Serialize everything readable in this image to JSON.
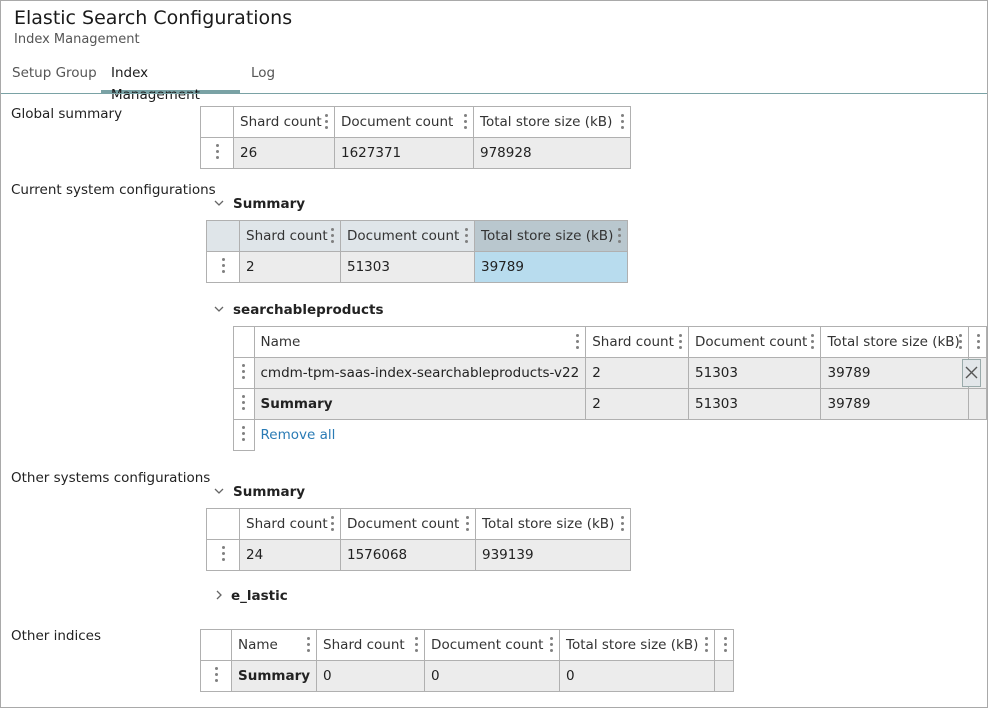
{
  "header": {
    "title": "Elastic Search Configurations",
    "subtitle": "Index Management"
  },
  "tabs": [
    {
      "label": "Setup Group",
      "active": false
    },
    {
      "label": "Index Management",
      "active": true
    },
    {
      "label": "Log",
      "active": false
    }
  ],
  "labels": {
    "global": "Global summary",
    "current": "Current system configurations",
    "other_systems": "Other systems configurations",
    "other_indices": "Other indices"
  },
  "columns": {
    "name": "Name",
    "shard": "Shard count",
    "doc": "Document count",
    "size": "Total store size (kB)"
  },
  "global_summary": {
    "shard": "26",
    "doc": "1627371",
    "size": "978928"
  },
  "current": {
    "summary_title": "Summary",
    "summary": {
      "shard": "2",
      "doc": "51303",
      "size": "39789"
    },
    "group_title": "searchableproducts",
    "rows": [
      {
        "name": "cmdm-tpm-saas-index-searchableproducts-v22",
        "shard": "2",
        "doc": "51303",
        "size": "39789"
      }
    ],
    "summary_row": {
      "name": "Summary",
      "shard": "2",
      "doc": "51303",
      "size": "39789"
    },
    "remove_all": "Remove all"
  },
  "other_systems": {
    "summary_title": "Summary",
    "summary": {
      "shard": "24",
      "doc": "1576068",
      "size": "939139"
    },
    "group_title": "e_lastic"
  },
  "other_indices": {
    "summary_row": {
      "name": "Summary",
      "shard": "0",
      "doc": "0",
      "size": "0"
    }
  },
  "colors": {
    "accent": "#7aa2a5",
    "selected_cell": "#b8dcee",
    "link": "#2a7bb5"
  }
}
